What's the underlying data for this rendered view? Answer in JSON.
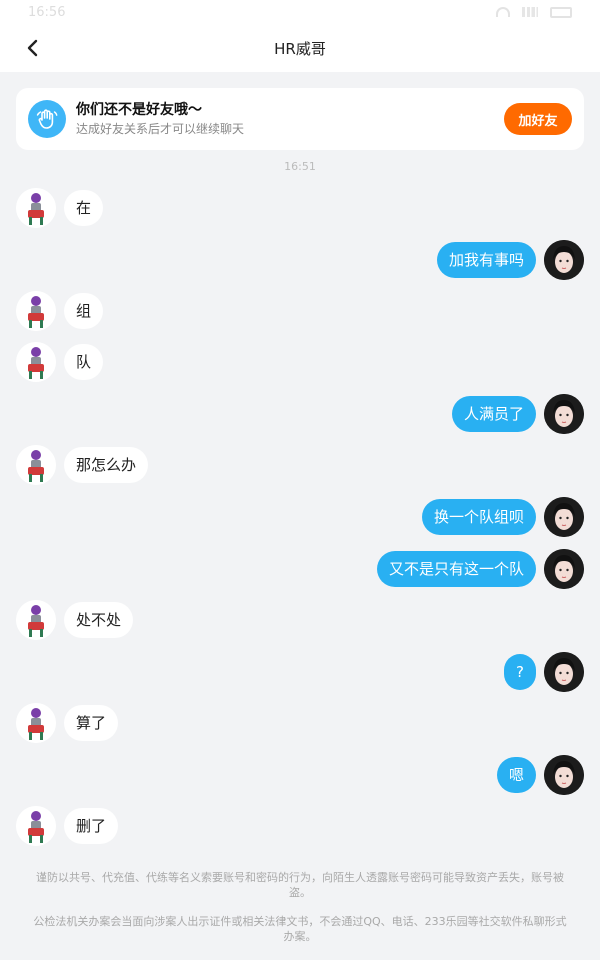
{
  "status_bar": {
    "time": "16:56"
  },
  "header": {
    "title": "HR威哥"
  },
  "friend_banner": {
    "title": "你们还不是好友哦～",
    "subtitle": "达成好友关系后才可以继续聊天",
    "button_label": "加好友"
  },
  "timestamp": "16:51",
  "messages": [
    {
      "side": "left",
      "text": "在"
    },
    {
      "side": "right",
      "text": "加我有事吗"
    },
    {
      "side": "left",
      "text": "组"
    },
    {
      "side": "left",
      "text": "队"
    },
    {
      "side": "right",
      "text": "人满员了"
    },
    {
      "side": "left",
      "text": "那怎么办"
    },
    {
      "side": "right",
      "text": "换一个队组呗"
    },
    {
      "side": "right",
      "text": "又不是只有这一个队"
    },
    {
      "side": "left",
      "text": "处不处"
    },
    {
      "side": "right",
      "text": "?"
    },
    {
      "side": "left",
      "text": "算了"
    },
    {
      "side": "right",
      "text": "嗯"
    },
    {
      "side": "left",
      "text": "删了"
    }
  ],
  "notices": {
    "line1": "谨防以共号、代充值、代练等名义索要账号和密码的行为，向陌生人透露账号密码可能导致资产丢失，账号被盗。",
    "line2": "公检法机关办案会当面向涉案人出示证件或相关法律文书，不会通过QQ、电话、233乐园等社交软件私聊形式办案。"
  },
  "colors": {
    "accent": "#29b0f2",
    "add_button": "#ff6a00"
  }
}
